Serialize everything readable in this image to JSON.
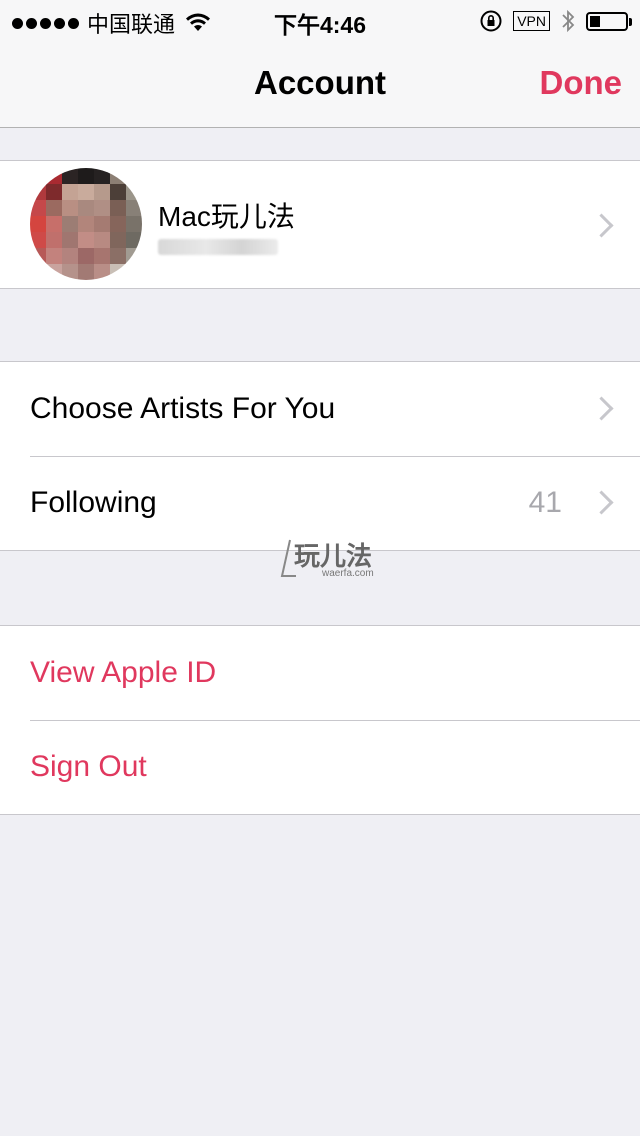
{
  "status_bar": {
    "carrier": "中国联通",
    "time": "下午4:46",
    "vpn": "VPN",
    "battery_level": 0.3
  },
  "nav": {
    "title": "Account",
    "done_label": "Done"
  },
  "profile": {
    "name": "Mac玩儿法"
  },
  "recommendations": {
    "items": [
      {
        "label": "Choose Artists For You"
      },
      {
        "label": "Following",
        "value": "41"
      }
    ]
  },
  "apple_id": {
    "items": [
      {
        "label": "View Apple ID"
      },
      {
        "label": "Sign Out"
      }
    ]
  },
  "watermark": {
    "text": "玩儿法",
    "sub": "waerfa.com"
  },
  "colors": {
    "accent": "#e0385e",
    "background": "#efeff4"
  }
}
